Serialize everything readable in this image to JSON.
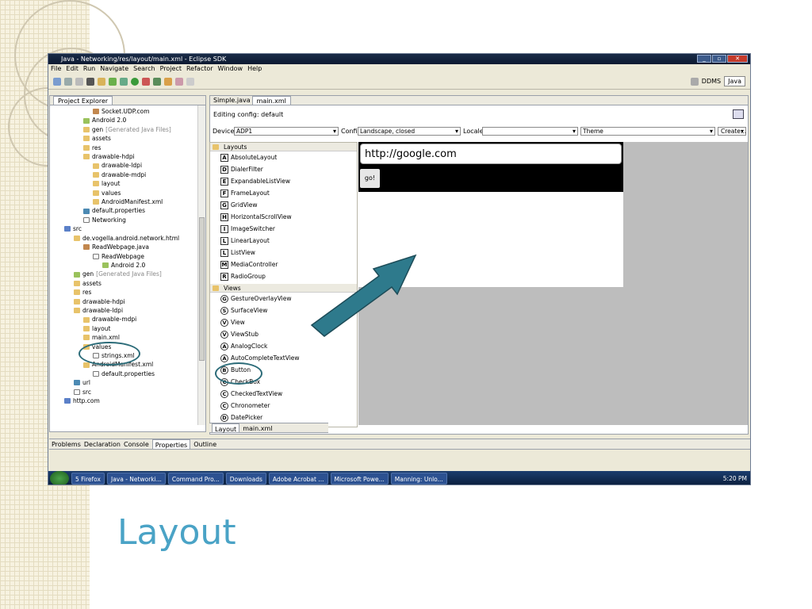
{
  "slide": {
    "title": "Layout"
  },
  "window": {
    "title": "Java - Networking/res/layout/main.xml - Eclipse SDK"
  },
  "menu": [
    "File",
    "Edit",
    "Run",
    "Navigate",
    "Search",
    "Project",
    "Refactor",
    "Window",
    "Help"
  ],
  "perspectives": {
    "ddms": "DDMS",
    "java": "Java"
  },
  "project_explorer": {
    "title": "Project Explorer",
    "items": [
      "Socket.UDP.com",
      "Android 2.0",
      "gen",
      "[Generated Java Files]",
      "assets",
      "res",
      "drawable-hdpi",
      "drawable-ldpi",
      "drawable-mdpi",
      "layout",
      "values",
      "AndroidManifest.xml",
      "default.properties",
      "Networking",
      "src",
      "de.vogella.android.network.html",
      "ReadWebpage.java",
      "ReadWebpage",
      "Android 2.0",
      "gen",
      "[Generated Java Files]",
      "assets",
      "res",
      "drawable-hdpi",
      "drawable-ldpi",
      "drawable-mdpi",
      "layout",
      "main.xml",
      "values",
      "strings.xml",
      "AndroidManifest.xml",
      "default.properties",
      "url",
      "src",
      "http.com"
    ]
  },
  "editor": {
    "tabs": [
      "Simple.java",
      "main.xml"
    ],
    "config_label": "Editing config: default",
    "devices_label": "Devices",
    "device": "ADP1",
    "config_field_label": "Config",
    "config_value": "Landscape, closed",
    "locale_label": "Locale",
    "locale_value": "",
    "theme_value": "Theme",
    "create_label": "Create...",
    "bottom_tabs": [
      "Layout",
      "main.xml"
    ]
  },
  "palette": {
    "layouts_header": "Layouts",
    "layouts": [
      {
        "b": "A",
        "t": "AbsoluteLayout"
      },
      {
        "b": "D",
        "t": "DialerFilter"
      },
      {
        "b": "E",
        "t": "ExpandableListView"
      },
      {
        "b": "F",
        "t": "FrameLayout"
      },
      {
        "b": "G",
        "t": "GridView"
      },
      {
        "b": "H",
        "t": "HorizontalScrollView"
      },
      {
        "b": "I",
        "t": "ImageSwitcher"
      },
      {
        "b": "L",
        "t": "LinearLayout"
      },
      {
        "b": "L",
        "t": "ListView"
      },
      {
        "b": "M",
        "t": "MediaController"
      },
      {
        "b": "R",
        "t": "RadioGroup"
      }
    ],
    "views_header": "Views",
    "views": [
      {
        "b": "G",
        "t": "GestureOverlayView"
      },
      {
        "b": "S",
        "t": "SurfaceView"
      },
      {
        "b": "V",
        "t": "View"
      },
      {
        "b": "V",
        "t": "ViewStub"
      },
      {
        "b": "A",
        "t": "AnalogClock"
      },
      {
        "b": "A",
        "t": "AutoCompleteTextView"
      },
      {
        "b": "B",
        "t": "Button"
      },
      {
        "b": "C",
        "t": "CheckBox"
      },
      {
        "b": "C",
        "t": "CheckedTextView"
      },
      {
        "b": "C",
        "t": "Chronometer"
      },
      {
        "b": "D",
        "t": "DatePicker"
      }
    ]
  },
  "preview": {
    "url_text": "http://google.com",
    "button_text": "go!"
  },
  "bottom_tabs": [
    "Problems",
    "Declaration",
    "Console",
    "Properties",
    "Outline"
  ],
  "taskbar": {
    "items": [
      "5 Firefox",
      "Java - Networki...",
      "Command Pro...",
      "Downloads",
      "Adobe Acrobat ...",
      "Microsoft Powe...",
      "Manning: Unlo..."
    ],
    "clock": "5:20 PM"
  },
  "colors": {
    "accent": "#4aa3c6",
    "arrow": "#2e7a8c",
    "highlight": "#2c6c79"
  }
}
